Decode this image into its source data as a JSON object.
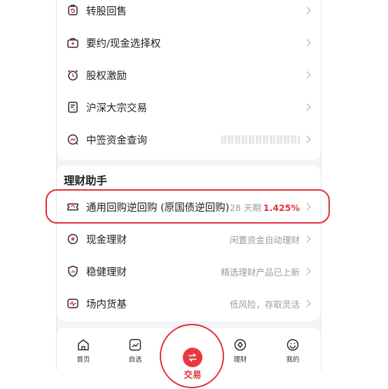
{
  "menu_top": [
    {
      "label": "转股回售",
      "icon": "box-return-icon"
    },
    {
      "label": "要约/现金选择权",
      "icon": "briefcase-icon"
    },
    {
      "label": "股权激励",
      "icon": "alarm-clock-icon"
    },
    {
      "label": "沪深大宗交易",
      "icon": "document-icon"
    },
    {
      "label": "中签资金查询",
      "icon": "chart-search-icon"
    }
  ],
  "finance": {
    "title": "理财助手",
    "items": [
      {
        "label": "通用回购逆回购 (原国债逆回购)",
        "right": "28 天期",
        "rate": "1.425%",
        "icon": "ticket-icon"
      },
      {
        "label": "现金理财",
        "right": "闲置资金自动理财",
        "icon": "target-icon"
      },
      {
        "label": "稳健理财",
        "right": "精选理财产品已上新",
        "icon": "shield-chart-icon"
      },
      {
        "label": "场内货基",
        "right": "低风险，存取灵活",
        "icon": "pulse-icon"
      }
    ]
  },
  "tabbar": {
    "home": "首页",
    "watchlist": "自选",
    "trade": "交易",
    "finance": "理财",
    "me": "我的"
  },
  "colors": {
    "accent": "#e73a3f",
    "highlight": "#e0303a",
    "text": "#1f1f24",
    "secondary": "#9a9aa2"
  }
}
